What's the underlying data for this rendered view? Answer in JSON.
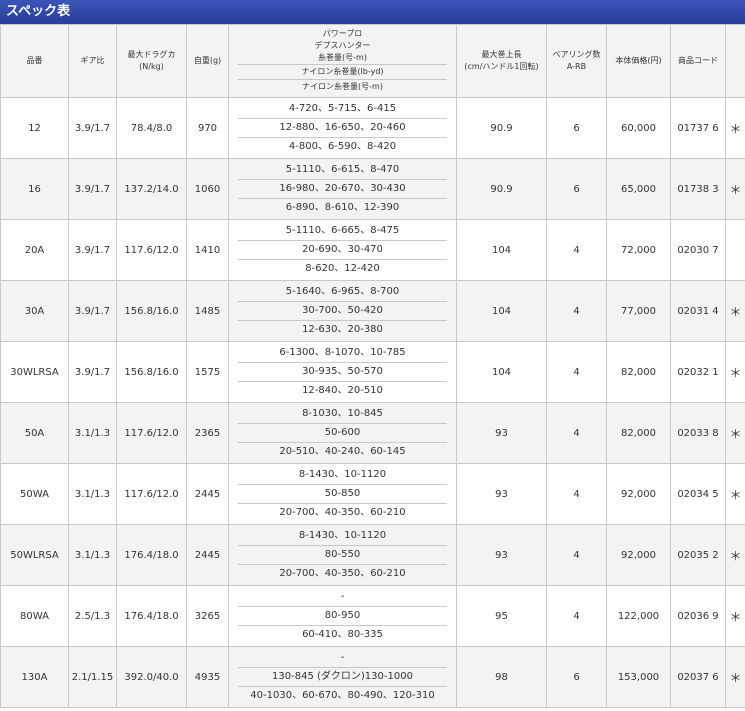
{
  "title": "スペック表",
  "headers": {
    "model": "品番",
    "gear": "ギア比",
    "drag": "最大ドラグカ",
    "drag_unit": "(N/kg)",
    "weight": "自重(g)",
    "line_title1": "パワープロ",
    "line_title2": "デプスハンター",
    "line_title3": "糸巻量(号-m)",
    "line_nylon_lb": "ナイロン糸巻量(lb-yd)",
    "line_nylon_go": "ナイロン糸巻量(号-m)",
    "retrieve": "最大巻上長",
    "retrieve_unit": "(cm/ハンドル1回転)",
    "bearing": "ベアリング数",
    "bearing_unit": "A-RB",
    "price": "本体価格(円)",
    "code": "商品コード"
  },
  "rows": [
    {
      "model": "12",
      "gear": "3.9/1.7",
      "drag": "78.4/8.0",
      "weight": "970",
      "lines": [
        "4-720、5-715、6-415",
        "12-880、16-650、20-460",
        "4-800、6-590、8-420"
      ],
      "retrieve": "90.9",
      "bearing": "6",
      "price": "60,000",
      "code": "01737 6",
      "mark": "＊"
    },
    {
      "model": "16",
      "gear": "3.9/1.7",
      "drag": "137.2/14.0",
      "weight": "1060",
      "lines": [
        "5-1110、6-615、8-470",
        "16-980、20-670、30-430",
        "6-890、8-610、12-390"
      ],
      "retrieve": "90.9",
      "bearing": "6",
      "price": "65,000",
      "code": "01738 3",
      "mark": "＊"
    },
    {
      "model": "20A",
      "gear": "3.9/1.7",
      "drag": "117.6/12.0",
      "weight": "1410",
      "lines": [
        "5-1110、6-665、8-475",
        "20-690、30-470",
        "8-620、12-420"
      ],
      "retrieve": "104",
      "bearing": "4",
      "price": "72,000",
      "code": "02030 7",
      "mark": ""
    },
    {
      "model": "30A",
      "gear": "3.9/1.7",
      "drag": "156.8/16.0",
      "weight": "1485",
      "lines": [
        "5-1640、6-965、8-700",
        "30-700、50-420",
        "12-630、20-380"
      ],
      "retrieve": "104",
      "bearing": "4",
      "price": "77,000",
      "code": "02031 4",
      "mark": "＊"
    },
    {
      "model": "30WLRSA",
      "gear": "3.9/1.7",
      "drag": "156.8/16.0",
      "weight": "1575",
      "lines": [
        "6-1300、8-1070、10-785",
        "30-935、50-570",
        "12-840、20-510"
      ],
      "retrieve": "104",
      "bearing": "4",
      "price": "82,000",
      "code": "02032 1",
      "mark": "＊"
    },
    {
      "model": "50A",
      "gear": "3.1/1.3",
      "drag": "117.6/12.0",
      "weight": "2365",
      "lines": [
        "8-1030、10-845",
        "50-600",
        "20-510、40-240、60-145"
      ],
      "retrieve": "93",
      "bearing": "4",
      "price": "82,000",
      "code": "02033 8",
      "mark": "＊"
    },
    {
      "model": "50WA",
      "gear": "3.1/1.3",
      "drag": "117.6/12.0",
      "weight": "2445",
      "lines": [
        "8-1430、10-1120",
        "50-850",
        "20-700、40-350、60-210"
      ],
      "retrieve": "93",
      "bearing": "4",
      "price": "92,000",
      "code": "02034 5",
      "mark": "＊"
    },
    {
      "model": "50WLRSA",
      "gear": "3.1/1.3",
      "drag": "176.4/18.0",
      "weight": "2445",
      "lines": [
        "8-1430、10-1120",
        "80-550",
        "20-700、40-350、60-210"
      ],
      "retrieve": "93",
      "bearing": "4",
      "price": "92,000",
      "code": "02035 2",
      "mark": "＊"
    },
    {
      "model": "80WA",
      "gear": "2.5/1.3",
      "drag": "176.4/18.0",
      "weight": "3265",
      "lines": [
        "-",
        "80-950",
        "60-410、80-335"
      ],
      "retrieve": "95",
      "bearing": "4",
      "price": "122,000",
      "code": "02036 9",
      "mark": "＊"
    },
    {
      "model": "130A",
      "gear": "2.1/1.15",
      "drag": "392.0/40.0",
      "weight": "4935",
      "lines": [
        "-",
        "130-845 (ダクロン)130-1000",
        "40-1030、60-670、80-490、120-310"
      ],
      "retrieve": "98",
      "bearing": "6",
      "price": "153,000",
      "code": "02037 6",
      "mark": "＊"
    }
  ]
}
